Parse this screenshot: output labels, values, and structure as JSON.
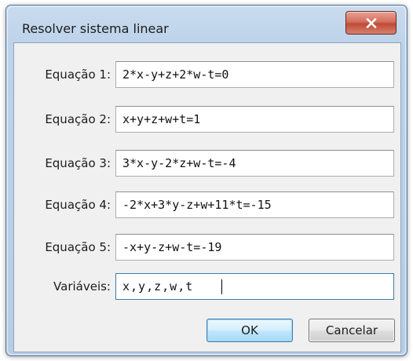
{
  "window": {
    "title": "Resolver sistema linear",
    "close_icon": "close-x-icon"
  },
  "form": {
    "rows": [
      {
        "label": "Equação 1:",
        "value": "2*x-y+z+2*w-t=0"
      },
      {
        "label": "Equação 2:",
        "value": "x+y+z+w+t=1"
      },
      {
        "label": "Equação 3:",
        "value": "3*x-y-2*z+w-t=-4"
      },
      {
        "label": "Equação 4:",
        "value": "-2*x+3*y-z+w+11*t=-15"
      },
      {
        "label": "Equação 5:",
        "value": "-x+y-z+w-t=-19"
      },
      {
        "label": "Variáveis:",
        "value": "x,y,z,w,t"
      }
    ]
  },
  "buttons": {
    "ok_label": "OK",
    "cancel_label": "Cancelar"
  },
  "colors": {
    "frame": "#bcd2ea",
    "client_bg": "#f0f0f0",
    "close_button": "#c14a36",
    "default_button_border": "#3c7fb1"
  }
}
